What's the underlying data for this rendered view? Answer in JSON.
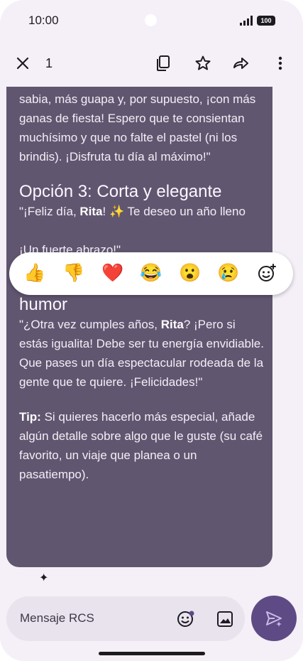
{
  "status": {
    "time": "10:00",
    "battery": "100"
  },
  "appbar": {
    "selected_count": "1"
  },
  "message": {
    "intro_lines": "sabia, más guapa y, por supuesto, ¡con más ganas de fiesta! Espero que te consientan muchísimo y que no falte el pastel (ni los brindis). ¡Disfruta tu día al máximo!\"",
    "option3_title": "Opción 3: Corta y elegante",
    "option3_pre": "\"¡Feliz día, ",
    "option3_name": "Rita",
    "option3_post": "! ✨ Te deseo un año lleno",
    "option3_tail": "¡Un fuerte abrazo!\"",
    "option4_title": "Opción 4: Con un toque de humor",
    "option4_pre": "\"¿Otra vez cumples años, ",
    "option4_name": "Rita",
    "option4_post": "? ¡Pero si estás igualita! Debe ser tu energía envidiable. Que pases un día espectacular rodeada de la gente que te quiere. ¡Felicidades!\"",
    "tip_label": "Tip:",
    "tip_text": " Si quieres hacerlo más especial, añade algún detalle sobre algo que le guste (su café favorito, un viaje que planea o un pasatiempo)."
  },
  "reactions": [
    "👍",
    "👎",
    "❤️",
    "😂",
    "😮",
    "😢"
  ],
  "composer": {
    "placeholder": "Mensaje RCS"
  },
  "colors": {
    "bubble": "#615670",
    "send": "#5e4a84",
    "background": "#f5eff7"
  }
}
